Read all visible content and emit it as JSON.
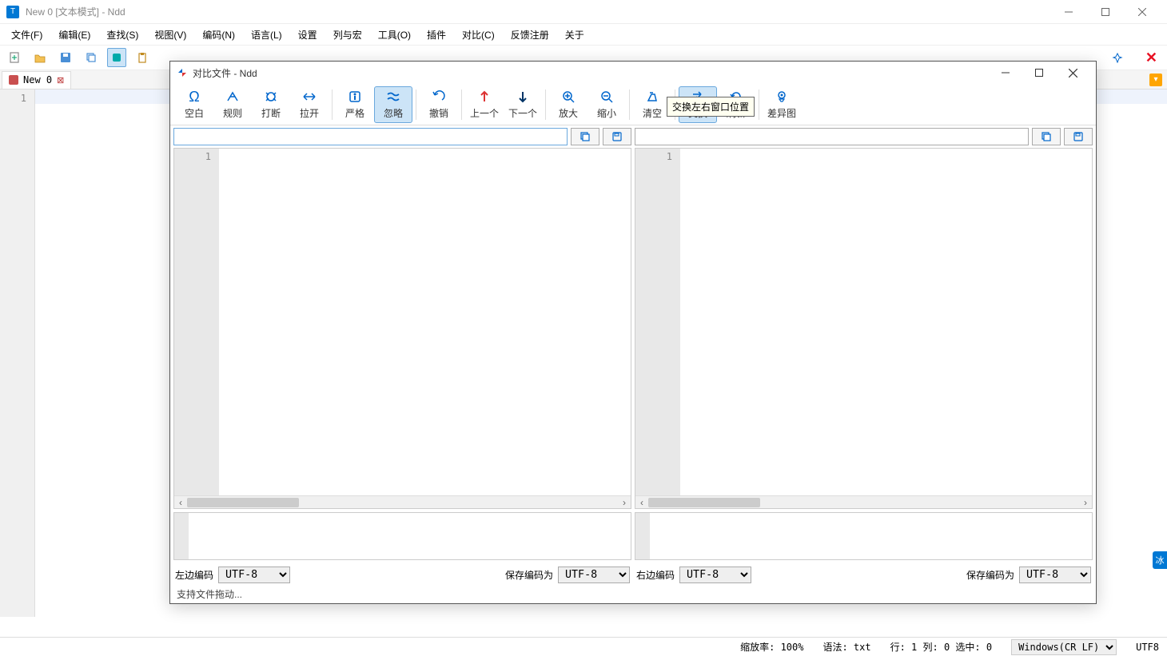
{
  "main": {
    "title": "New 0 [文本模式] - Ndd",
    "menus": [
      "文件(F)",
      "编辑(E)",
      "查找(S)",
      "视图(V)",
      "编码(N)",
      "语言(L)",
      "设置",
      "列与宏",
      "工具(O)",
      "插件",
      "对比(C)",
      "反馈注册",
      "关于"
    ],
    "tab_name": "New 0",
    "line_number": "1"
  },
  "dialog": {
    "title": "对比文件 - Ndd",
    "tools": [
      {
        "label": "空白"
      },
      {
        "label": "规则"
      },
      {
        "label": "打断"
      },
      {
        "label": "拉开"
      },
      {
        "label": "严格"
      },
      {
        "label": "忽略"
      },
      {
        "label": "撤销"
      },
      {
        "label": "上一个"
      },
      {
        "label": "下一个"
      },
      {
        "label": "放大"
      },
      {
        "label": "缩小"
      },
      {
        "label": "清空"
      },
      {
        "label": "交换"
      },
      {
        "label": "刷新"
      },
      {
        "label": "差异图"
      }
    ],
    "tooltip": "交换左右窗口位置",
    "left_line": "1",
    "right_line": "1",
    "left_enc_label": "左边编码",
    "right_enc_label": "右边编码",
    "save_enc_label": "保存编码为",
    "enc_value": "UTF-8",
    "status_text": "支持文件拖动..."
  },
  "status": {
    "zoom": "缩放率: 100%",
    "lang": "语法: txt",
    "pos": "行: 1 列: 0 选中: 0",
    "eol": "Windows(CR LF)",
    "enc": "UTF8"
  },
  "float_label": "冰"
}
